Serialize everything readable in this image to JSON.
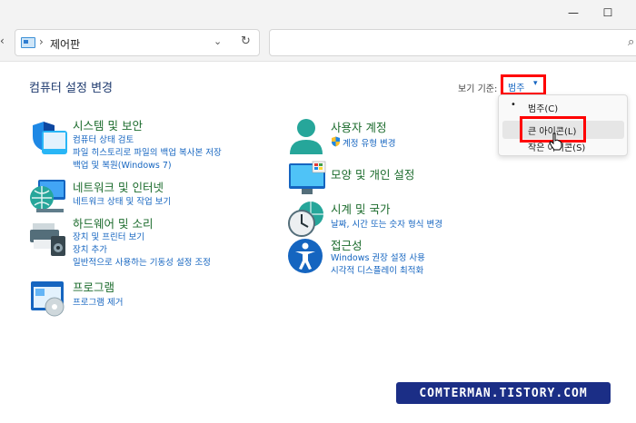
{
  "window": {
    "minimize_glyph": "—",
    "maximize_glyph": "☐",
    "close_glyph": "✕"
  },
  "toolbar": {
    "back_glyph": "‹",
    "address_separator": "›",
    "address_text": "제어판",
    "address_chevron": "⌄",
    "refresh_glyph": "↻",
    "search_glyph": "⌕"
  },
  "header": {
    "title": "컴퓨터 설정 변경",
    "view_by_label": "보기 기준:",
    "view_by_value": "범주",
    "view_by_caret": "▾"
  },
  "dropdown": {
    "bullet": "•",
    "items": [
      "범주(C)",
      "큰 아이콘(L)",
      "작은 아이콘(S)"
    ]
  },
  "categories": [
    {
      "id": "system-security",
      "icon": "shield-icon",
      "title": "시스템 및 보안",
      "links": [
        "컴퓨터 상태 검토",
        "파일 히스토리로 파일의 백업 복사본 저장",
        "백업 및 복원(Windows 7)"
      ]
    },
    {
      "id": "network-internet",
      "icon": "network-globe-icon",
      "title": "네트워크 및 인터넷",
      "links": [
        "네트워크 상태 및 작업 보기"
      ]
    },
    {
      "id": "hardware-sound",
      "icon": "printer-speaker-icon",
      "title": "하드웨어 및 소리",
      "links": [
        "장치 및 프린터 보기",
        "장치 추가",
        "일반적으로 사용하는 기동성 설정 조정"
      ]
    },
    {
      "id": "programs",
      "icon": "programs-icon",
      "title": "프로그램",
      "links": [
        "프로그램 제거"
      ]
    },
    {
      "id": "user-accounts",
      "icon": "user-icon",
      "title": "사용자 계정",
      "links": [
        "계정 유형 변경"
      ]
    },
    {
      "id": "appearance",
      "icon": "monitor-icon",
      "title": "모양 및 개인 설정",
      "links": []
    },
    {
      "id": "clock-region",
      "icon": "clock-globe-icon",
      "title": "시계 및 국가",
      "links": [
        "날짜, 시간 또는 숫자 형식 변경"
      ]
    },
    {
      "id": "ease-of-access",
      "icon": "accessibility-icon",
      "title": "접근성",
      "links": [
        "Windows 권장 설정 사용",
        "시각적 디스플레이 최적화"
      ]
    }
  ],
  "watermark": "COMTERMAN.TISTORY.COM",
  "colors": {
    "title_bar": "#f3f3f3",
    "category_title": "#1b6b2c",
    "link": "#1565c0",
    "highlight_box": "#ff0000",
    "watermark_bg": "#1b2e86"
  }
}
